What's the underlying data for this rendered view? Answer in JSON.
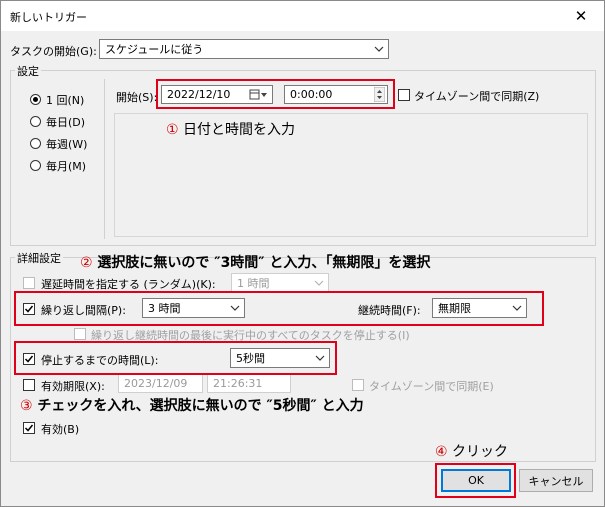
{
  "window": {
    "title": "新しいトリガー",
    "close": "✕"
  },
  "task_start": {
    "label": "タスクの開始(G):",
    "value": "スケジュールに従う"
  },
  "settings": {
    "group_title": "設定",
    "radios": [
      {
        "label": "1 回(N)",
        "checked": true
      },
      {
        "label": "毎日(D)",
        "checked": false
      },
      {
        "label": "毎週(W)",
        "checked": false
      },
      {
        "label": "毎月(M)",
        "checked": false
      }
    ],
    "start_label": "開始(S):",
    "start_date": "2022/12/10",
    "start_time": "0:00:00",
    "timezone_sync": "タイムゾーン間で同期(Z)"
  },
  "advanced": {
    "group_title": "詳細設定",
    "delay": {
      "label": "遅延時間を指定する (ランダム)(K):",
      "value": "1 時間",
      "checked": false
    },
    "repeat": {
      "label": "繰り返し間隔(P):",
      "value": "3 時間",
      "checked": true
    },
    "duration": {
      "label": "継続時間(F):",
      "value": "無期限"
    },
    "stop_all": {
      "label": "繰り返し継続時間の最後に実行中のすべてのタスクを停止する(I)",
      "checked": false
    },
    "stop_after": {
      "label": "停止するまでの時間(L):",
      "value": "5秒間",
      "checked": true
    },
    "expire": {
      "label": "有効期限(X):",
      "date": "2023/12/09",
      "time": "21:26:31",
      "checked": false
    },
    "expire_tz": {
      "label": "タイムゾーン間で同期(E)",
      "checked": false
    },
    "enabled": {
      "label": "有効(B)",
      "checked": true
    }
  },
  "buttons": {
    "ok": "OK",
    "cancel": "キャンセル"
  },
  "annotations": {
    "a1_num": "①",
    "a1_text": " 日付と時間を入力",
    "a2_num": "②",
    "a2_text": " 選択肢に無いので ″3時間″ と入力、「無期限」を選択",
    "a3_num": "③",
    "a3_text": " チェックを入れ、選択肢に無いので ″5秒間″ と入力",
    "a4_num": "④",
    "a4_text": " クリック"
  },
  "colors": {
    "highlight": "#e0001a",
    "annotation_number": "#d00000"
  }
}
